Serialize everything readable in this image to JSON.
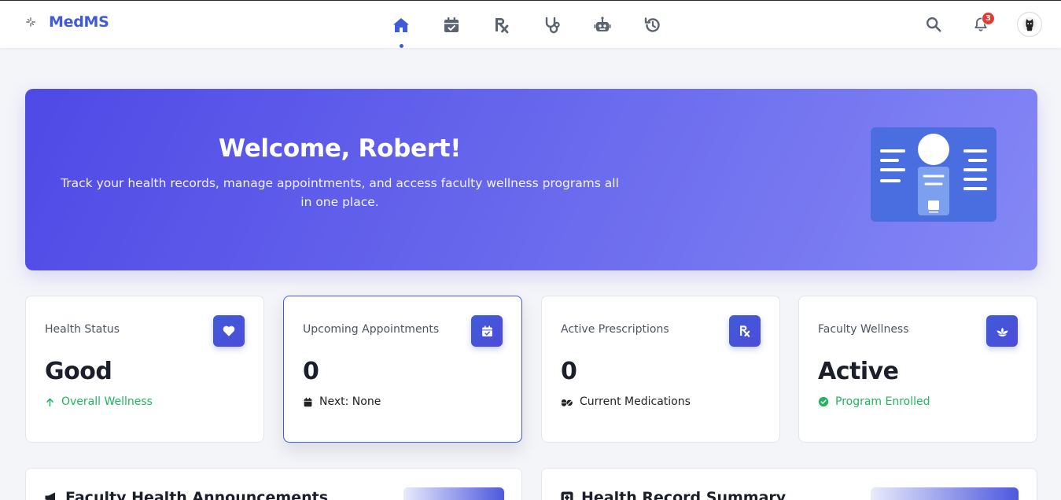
{
  "app": {
    "brand_name": "MedMS",
    "accent": "#3f5bd8",
    "nav": [
      {
        "id": "home",
        "icon": "home-icon",
        "active": true
      },
      {
        "id": "appointments",
        "icon": "calendar-check-icon"
      },
      {
        "id": "prescriptions",
        "icon": "prescription-icon"
      },
      {
        "id": "consultation",
        "icon": "stethoscope-icon"
      },
      {
        "id": "assistant",
        "icon": "robot-icon"
      },
      {
        "id": "history",
        "icon": "history-icon"
      }
    ],
    "notifications_count": "3"
  },
  "hero": {
    "title": "Welcome, Robert!",
    "subtitle": "Track your health records, manage appointments, and access faculty wellness programs all in one place."
  },
  "cards": [
    {
      "label": "Health Status",
      "value": "Good",
      "footer": "Overall Wellness",
      "icon": "heart-icon",
      "footer_icon": "arrow-up-icon"
    },
    {
      "label": "Upcoming Appointments",
      "value": "0",
      "footer": "Next: None",
      "icon": "calendar-check-icon",
      "footer_icon": "calendar-icon"
    },
    {
      "label": "Active Prescriptions",
      "value": "0",
      "footer": "Current Medications",
      "icon": "prescription-icon",
      "footer_icon": "pills-icon"
    },
    {
      "label": "Faculty Wellness",
      "value": "Active",
      "footer": "Program Enrolled",
      "icon": "lotus-icon",
      "footer_icon": "check-circle-icon"
    }
  ],
  "panels": [
    {
      "title": "Faculty Health Announcements",
      "icon": "megaphone-icon"
    },
    {
      "title": "Health Record Summary",
      "icon": "file-medical-icon"
    }
  ]
}
